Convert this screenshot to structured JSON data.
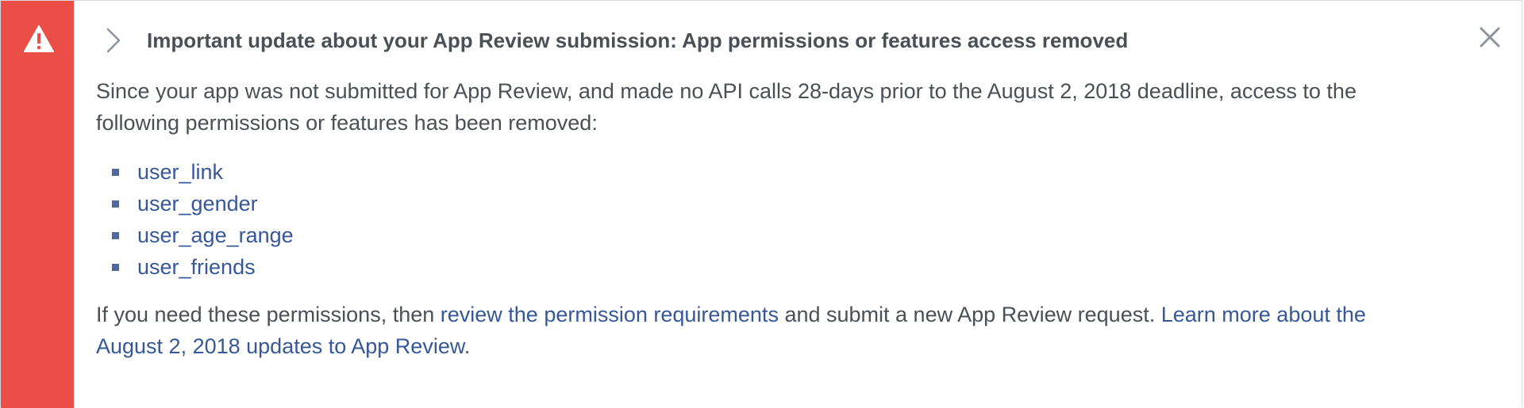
{
  "banner": {
    "title": "Important update about your App Review submission: App permissions or features access removed",
    "alert_icon": "warning-triangle-icon",
    "expand_icon": "chevron-right-icon",
    "close_icon": "close-icon",
    "colors": {
      "alert": "#ea4e47",
      "text": "#4b4f56",
      "link": "#365899"
    },
    "intro": "Since your app was not submitted for App Review, and made no API calls 28-days prior to the August 2, 2018 deadline, access to the following permissions or features has been removed:",
    "permissions": [
      "user_link",
      "user_gender",
      "user_age_range",
      "user_friends"
    ],
    "footer": {
      "text_before": "If you need these permissions, then ",
      "link_review": "review the permission requirements",
      "text_middle": " and submit a new App Review request. ",
      "link_learn": "Learn more about the August 2, 2018 updates to App Review",
      "text_end": "."
    }
  }
}
